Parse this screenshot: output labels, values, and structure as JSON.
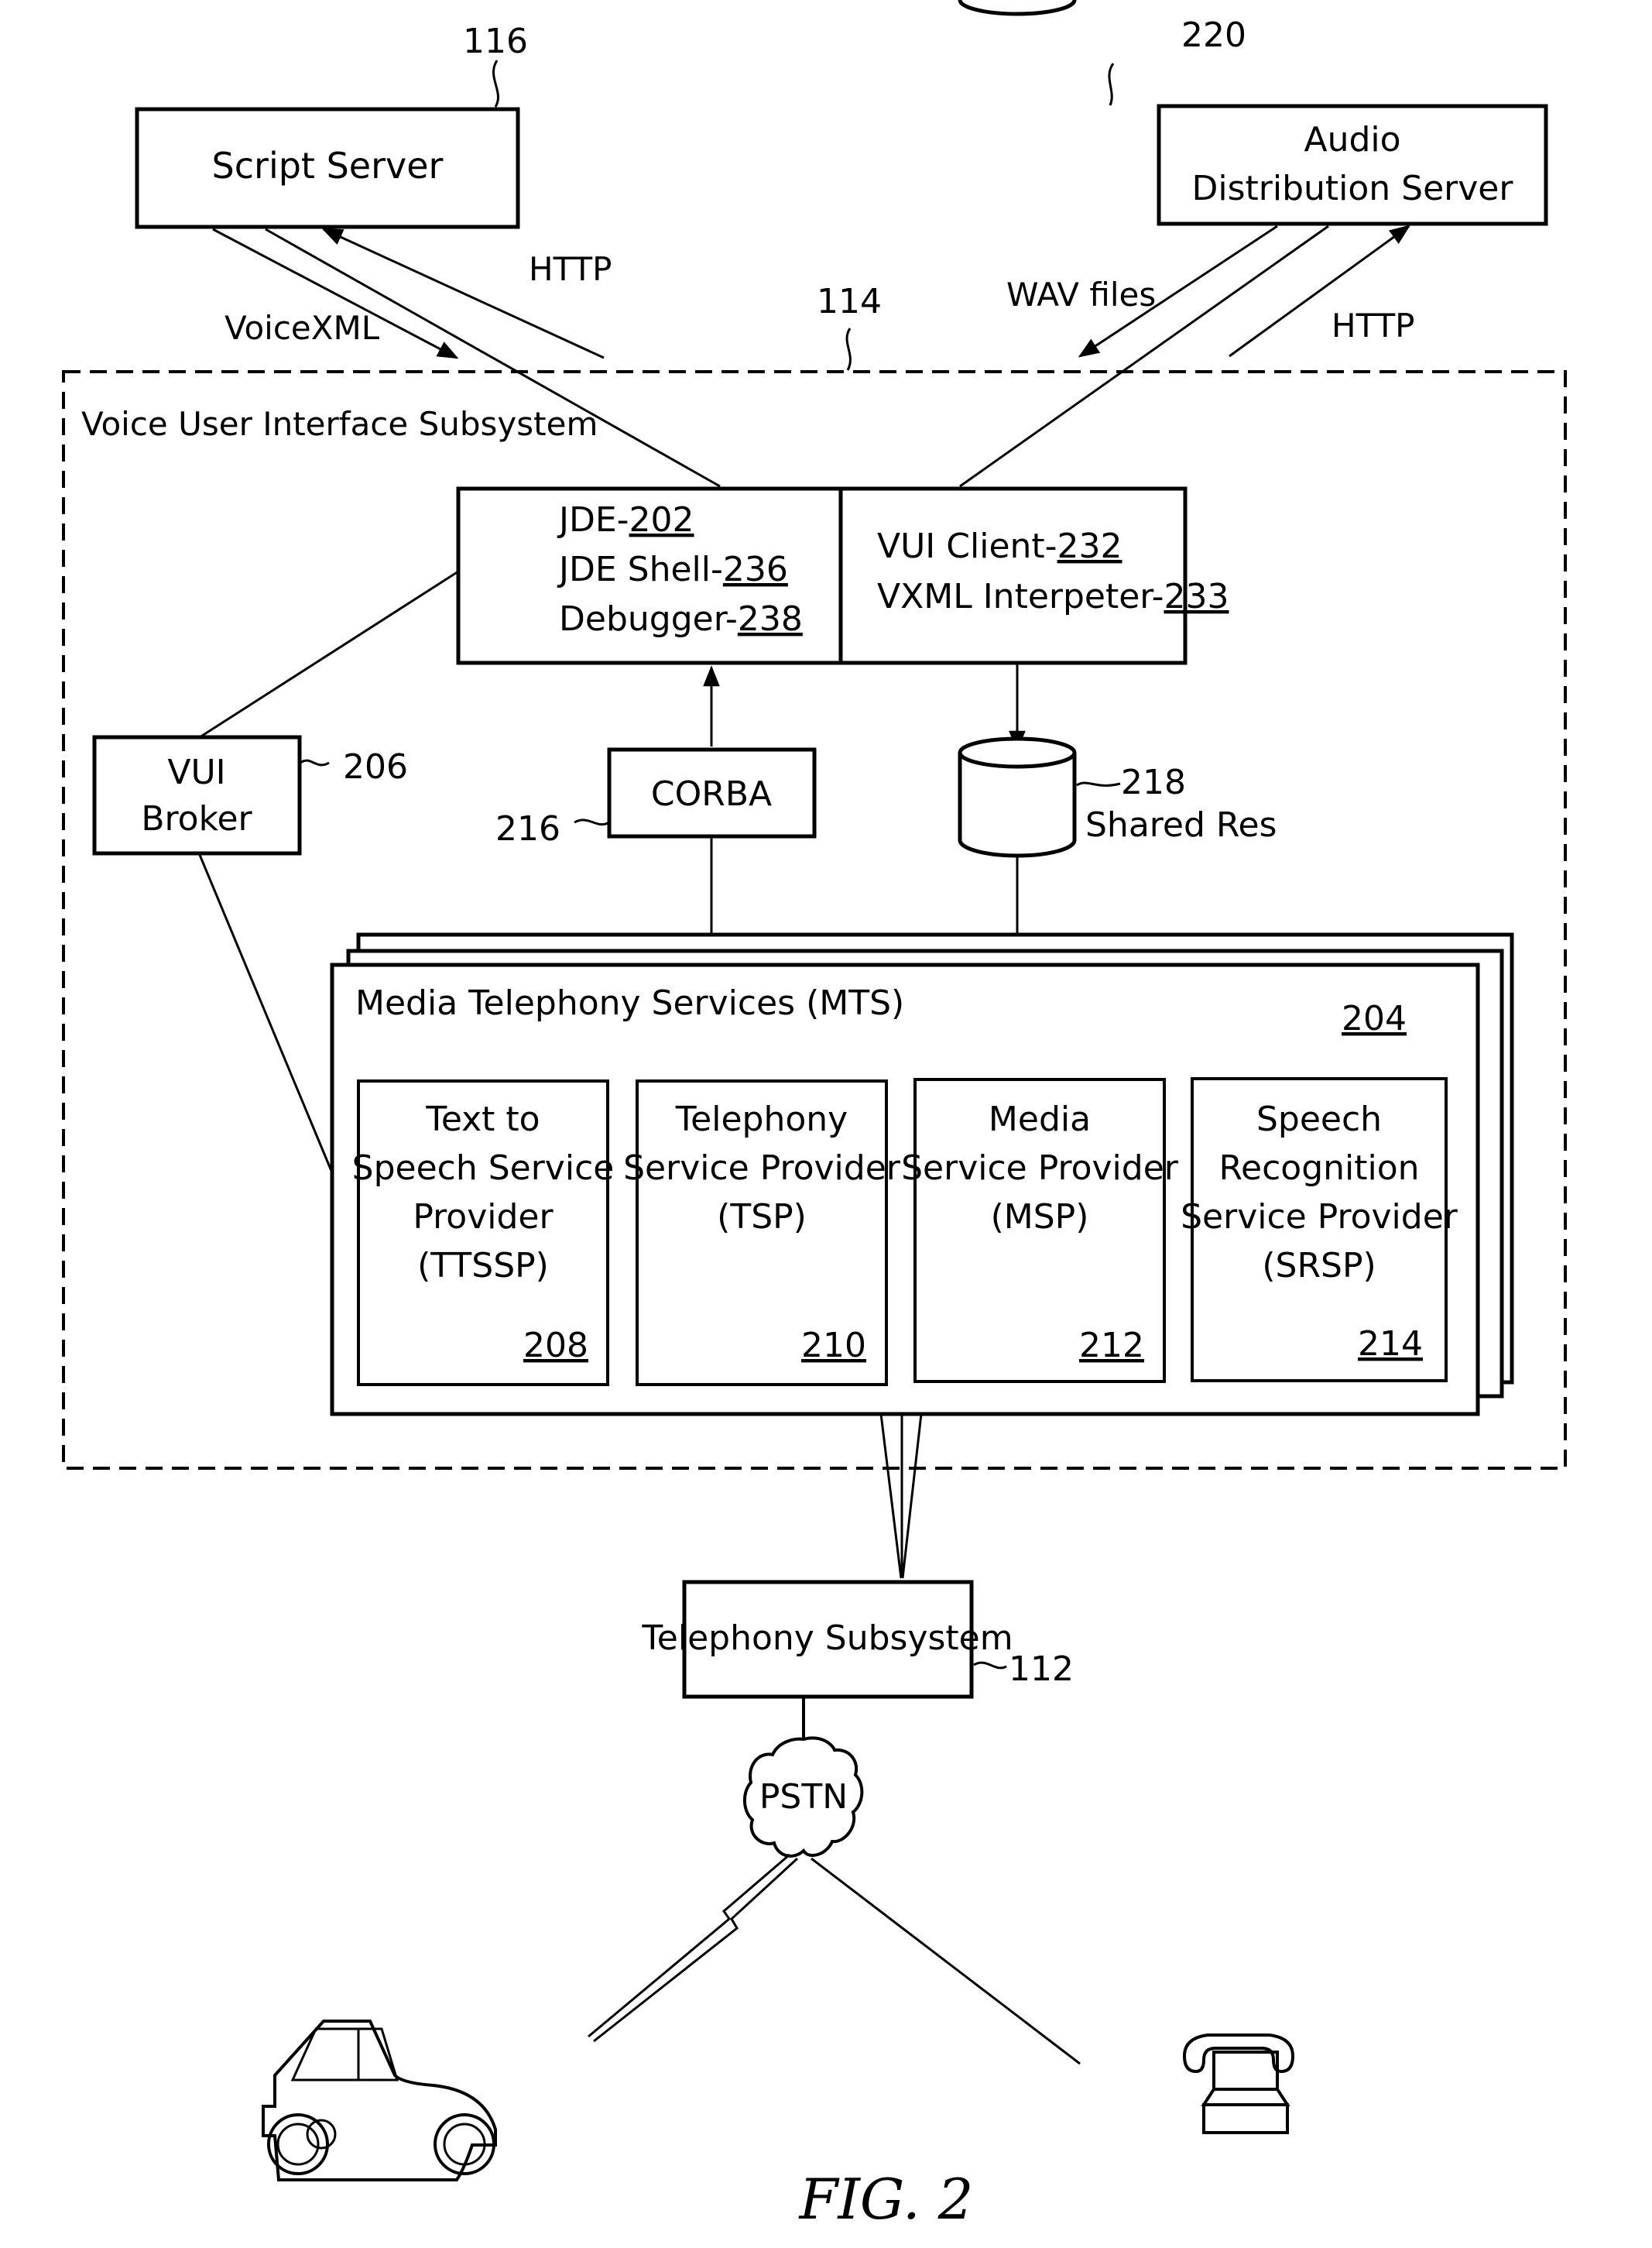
{
  "figure_label": "FIG. 2",
  "script_server": {
    "label": "Script Server",
    "ref": "116"
  },
  "audio_server": {
    "line1": "Audio",
    "line2": "Distribution Server",
    "ref": "220"
  },
  "links": {
    "voicexml": "VoiceXML",
    "http_script": "HTTP",
    "wav_files": "WAV files",
    "http_audio": "HTTP"
  },
  "vui_subsystem": {
    "label": "Voice User Interface Subsystem",
    "ref": "114"
  },
  "jde_box": {
    "lines": [
      {
        "text": "JDE-",
        "ref": "202"
      },
      {
        "text": "JDE Shell-",
        "ref": "236"
      },
      {
        "text": "Debugger-",
        "ref": "238"
      }
    ]
  },
  "vui_client_box": {
    "lines": [
      {
        "text": "VUI Client-",
        "ref": "232"
      },
      {
        "text": "VXML Interpeter-",
        "ref": "233"
      }
    ]
  },
  "vui_broker": {
    "line1": "VUI",
    "line2": "Broker",
    "ref": "206"
  },
  "corba": {
    "label": "CORBA",
    "ref": "216"
  },
  "shared_res": {
    "label": "Shared Res",
    "ref": "218"
  },
  "mts": {
    "label": "Media Telephony Services (MTS)",
    "ref": "204",
    "providers": [
      {
        "lines": [
          "Text to",
          "Speech Service",
          "Provider",
          "(TTSSP)"
        ],
        "ref": "208"
      },
      {
        "lines": [
          "Telephony",
          "Service Provider",
          "(TSP)"
        ],
        "ref": "210"
      },
      {
        "lines": [
          "Media",
          "Service Provider",
          "(MSP)"
        ],
        "ref": "212"
      },
      {
        "lines": [
          "Speech",
          "Recognition",
          "Service Provider",
          "(SRSP)"
        ],
        "ref": "214"
      }
    ]
  },
  "telephony_subsystem": {
    "label": "Telephony Subsystem",
    "ref": "112"
  },
  "pstn": {
    "label": "PSTN"
  },
  "endpoints": {
    "car": "car-icon",
    "phone": "telephone-icon"
  }
}
